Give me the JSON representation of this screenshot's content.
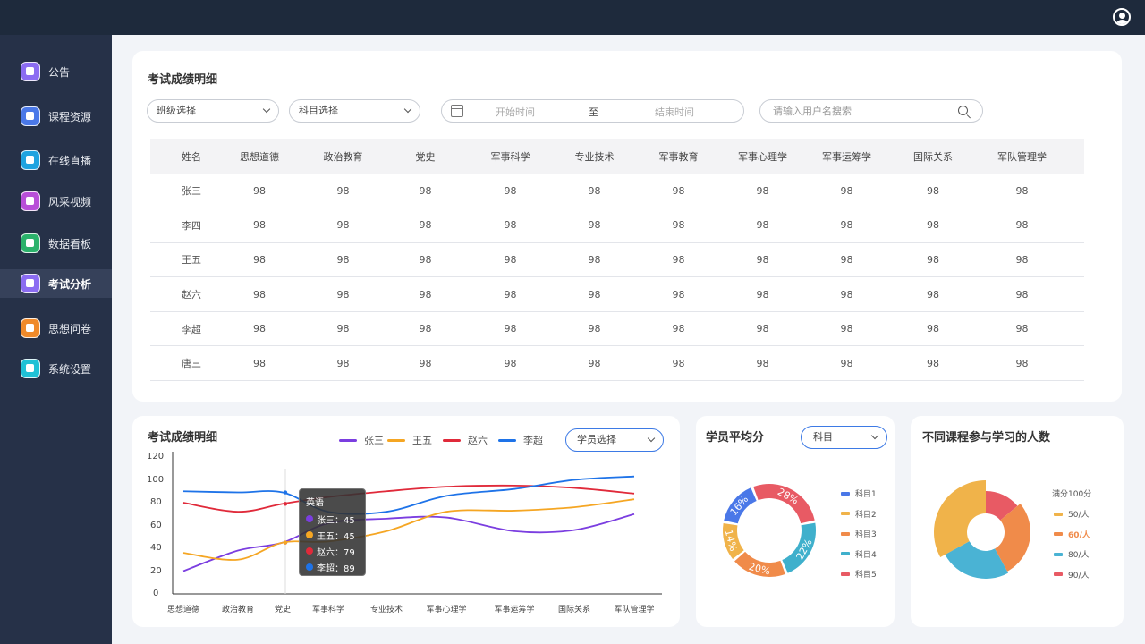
{
  "colors": {
    "accent": "#3d7ae5",
    "sidebar": "#263148",
    "topbar": "#1e2a3c"
  },
  "sidebar": {
    "items": [
      {
        "label": "公告",
        "icon": "megaphone-icon",
        "color": "#8b6cf2"
      },
      {
        "label": "课程资源",
        "icon": "book-icon",
        "color": "#4a78e8"
      },
      {
        "label": "在线直播",
        "icon": "video-icon",
        "color": "#1fa3e0"
      },
      {
        "label": "风采视频",
        "icon": "flower-icon",
        "color": "#b84fd8"
      },
      {
        "label": "数据看板",
        "icon": "bar-chart-icon",
        "color": "#2bb26b"
      },
      {
        "label": "考试分析",
        "icon": "trend-chart-icon",
        "color": "#8b6cf2"
      },
      {
        "label": "思想问卷",
        "icon": "document-icon",
        "color": "#f08a2a"
      },
      {
        "label": "系统设置",
        "icon": "gear-icon",
        "color": "#1fc1d6"
      }
    ],
    "active_index": 5
  },
  "table_card": {
    "title": "考试成绩明细",
    "class_select": "班级选择",
    "subject_select": "科目选择",
    "start_time": "开始时间",
    "to": "至",
    "end_time": "结束时间",
    "search_placeholder": "请输入用户名搜索",
    "columns": [
      "姓名",
      "思想道德",
      "政治教育",
      "党史",
      "军事科学",
      "专业技术",
      "军事教育",
      "军事心理学",
      "军事运筹学",
      "国际关系",
      "军队管理学"
    ],
    "rows": [
      [
        "张三",
        "98",
        "98",
        "98",
        "98",
        "98",
        "98",
        "98",
        "98",
        "98",
        "98"
      ],
      [
        "李四",
        "98",
        "98",
        "98",
        "98",
        "98",
        "98",
        "98",
        "98",
        "98",
        "98"
      ],
      [
        "王五",
        "98",
        "98",
        "98",
        "98",
        "98",
        "98",
        "98",
        "98",
        "98",
        "98"
      ],
      [
        "赵六",
        "98",
        "98",
        "98",
        "98",
        "98",
        "98",
        "98",
        "98",
        "98",
        "98"
      ],
      [
        "李超",
        "98",
        "98",
        "98",
        "98",
        "98",
        "98",
        "98",
        "98",
        "98",
        "98"
      ],
      [
        "唐三",
        "98",
        "98",
        "98",
        "98",
        "98",
        "98",
        "98",
        "98",
        "98",
        "98"
      ]
    ]
  },
  "line_card": {
    "title": "考试成绩明细",
    "student_select": "学员选择",
    "tooltip": {
      "title": "英语",
      "rows": [
        {
          "text": "张三：45",
          "color": "#7b3ee0"
        },
        {
          "text": "王五：45",
          "color": "#f5a623"
        },
        {
          "text": "赵六：79",
          "color": "#e02a3a"
        },
        {
          "text": "李超：89",
          "color": "#1e73e8"
        }
      ]
    }
  },
  "donut1_card": {
    "title": "学员平均分",
    "subject_select": "科目"
  },
  "donut2_card": {
    "title": "不同课程参与学习的人数",
    "legend_title": "满分100分"
  },
  "chart_data": [
    {
      "type": "line",
      "categories": [
        "思想道德",
        "政治教育",
        "党史",
        "军事科学",
        "专业技术",
        "军事心理学",
        "军事运筹学",
        "国际关系",
        "军队管理学"
      ],
      "ylim": [
        0,
        120
      ],
      "yticks": [
        "0",
        "20",
        "40",
        "60",
        "80",
        "100",
        "120"
      ],
      "series": [
        {
          "name": "张三",
          "color": "#7b3ee0",
          "values": [
            20,
            38,
            45,
            62,
            66,
            67,
            55,
            56,
            70
          ]
        },
        {
          "name": "王五",
          "color": "#f5a623",
          "values": [
            36,
            30,
            45,
            46,
            55,
            72,
            73,
            76,
            83
          ]
        },
        {
          "name": "赵六",
          "color": "#e02a3a",
          "values": [
            80,
            72,
            79,
            85,
            90,
            94,
            95,
            93,
            88
          ]
        },
        {
          "name": "李超",
          "color": "#1e73e8",
          "values": [
            90,
            89,
            89,
            72,
            72,
            86,
            92,
            100,
            103
          ]
        }
      ]
    },
    {
      "type": "pie",
      "labels": [
        "科目1",
        "科目2",
        "科目3",
        "科目4",
        "科目5"
      ],
      "colors": [
        "#4a78e8",
        "#f0b34a",
        "#f08b4a",
        "#3fb0cc",
        "#e85a64"
      ],
      "values": [
        16,
        14,
        20,
        22,
        28
      ],
      "value_labels": [
        "16%",
        "14%",
        "20%",
        "22%",
        "28%"
      ]
    },
    {
      "type": "pie",
      "labels": [
        "50/人",
        "60/人",
        "80/人",
        "90/人"
      ],
      "colors": [
        "#f0b34a",
        "#f08b4a",
        "#4ab3d4",
        "#e85a64"
      ],
      "highlight_index": 1,
      "values": [
        33,
        28,
        25,
        14
      ]
    }
  ]
}
